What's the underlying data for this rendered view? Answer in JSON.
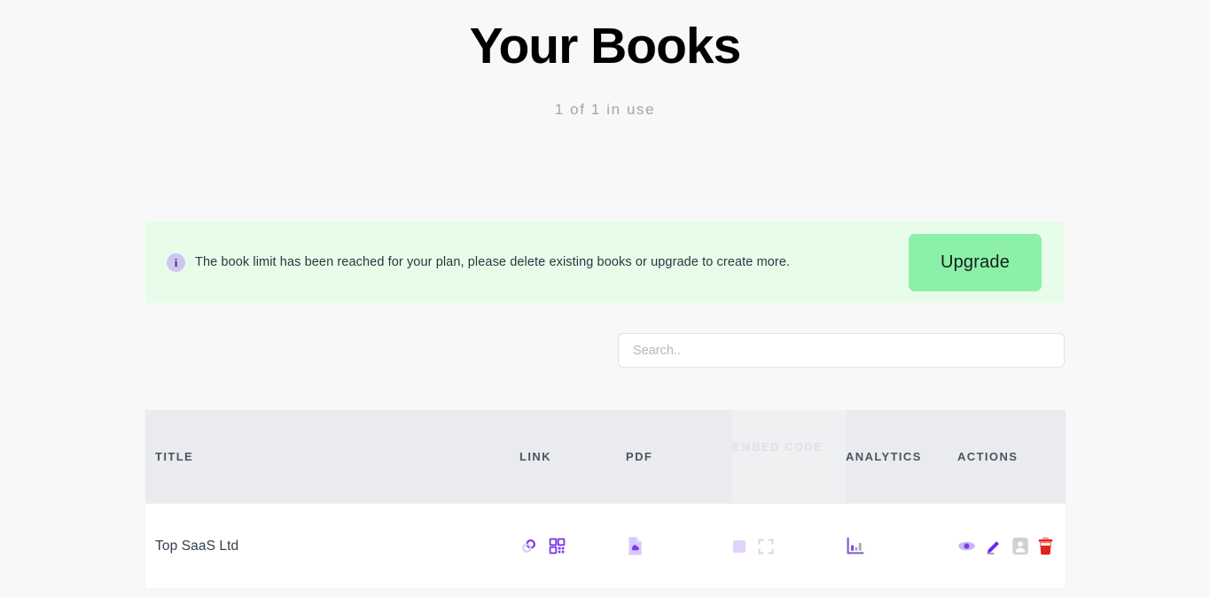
{
  "header": {
    "title": "Your Books",
    "usage": "1 of 1 in use"
  },
  "alert": {
    "icon": "info-icon",
    "message": "The book limit has been reached for your plan, please delete existing books or upgrade to create more.",
    "button_label": "Upgrade",
    "background_color": "#e8fde9",
    "button_color": "#8df0a9"
  },
  "search": {
    "placeholder": "Search..",
    "value": ""
  },
  "table": {
    "columns": [
      {
        "key": "title",
        "label": "Title",
        "dimmed": false
      },
      {
        "key": "link",
        "label": "Link",
        "dimmed": false
      },
      {
        "key": "pdf",
        "label": "PDF",
        "dimmed": false
      },
      {
        "key": "embed_code_line1",
        "label": "Embed",
        "dimmed": true
      },
      {
        "key": "embed_code_line2",
        "label": "Code",
        "dimmed": true
      },
      {
        "key": "analytics",
        "label": "Analytics",
        "dimmed": false
      },
      {
        "key": "actions",
        "label": "Actions",
        "dimmed": false
      }
    ],
    "rows": [
      {
        "title": "Top SaaS Ltd",
        "link_icons": [
          "chain-link-icon",
          "qr-code-icon"
        ],
        "pdf_icons": [
          "pdf-download-icon"
        ],
        "embed_icons": [
          "embed-square-icon",
          "expand-icon"
        ],
        "analytics_icons": [
          "bar-chart-icon"
        ],
        "action_icons": [
          "eye-icon",
          "pencil-icon",
          "contact-card-icon",
          "trash-icon"
        ]
      }
    ]
  },
  "colors": {
    "page_background": "#f8f8f9",
    "accent_purple": "#7c3aed",
    "accent_purple_light": "#c9b6f7",
    "danger_red": "#e2231a",
    "header_row": "#e9ebee"
  }
}
